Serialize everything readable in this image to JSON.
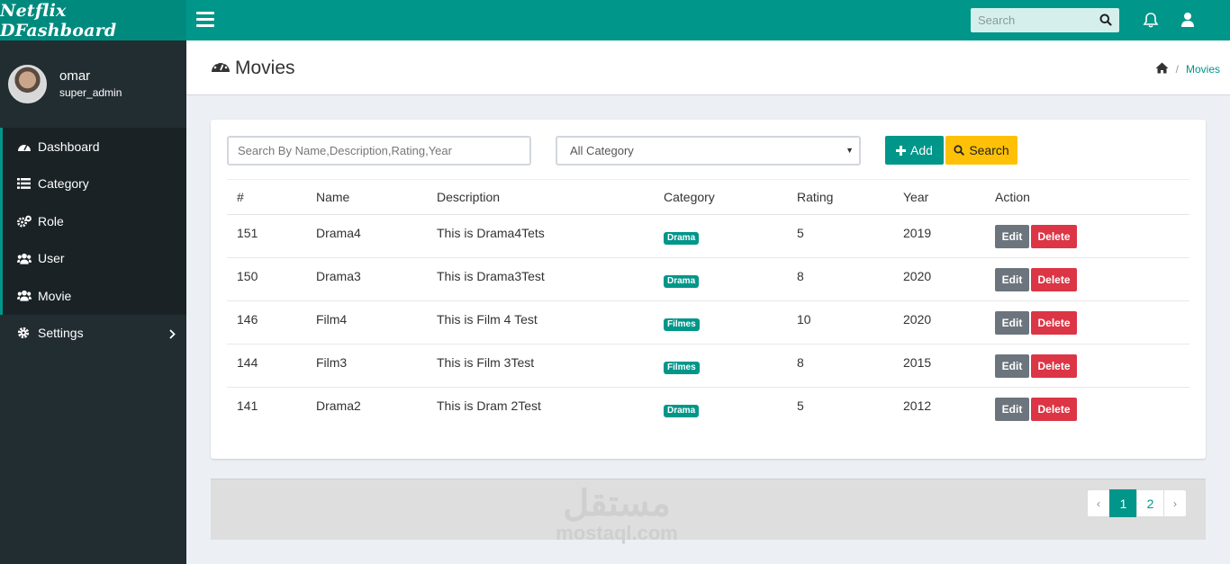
{
  "app": {
    "brand": "Netflix DFashboard"
  },
  "topbar": {
    "search_placeholder": "Search"
  },
  "user": {
    "name": "omar",
    "role": "super_admin"
  },
  "sidebar": {
    "items": [
      {
        "label": "Dashboard",
        "icon": "dashboard-icon",
        "active": true
      },
      {
        "label": "Category",
        "icon": "list-icon",
        "active": true
      },
      {
        "label": "Role",
        "icon": "cogs-icon",
        "active": true
      },
      {
        "label": "User",
        "icon": "users-icon",
        "active": true
      },
      {
        "label": "Movie",
        "icon": "users-icon",
        "active": true
      },
      {
        "label": "Settings",
        "icon": "gear-icon",
        "active": false
      }
    ]
  },
  "page": {
    "title": "Movies",
    "breadcrumb_current": "Movies"
  },
  "filters": {
    "search_placeholder": "Search By Name,Description,Rating,Year",
    "category_selected": "All Category",
    "add_label": "Add",
    "search_label": "Search"
  },
  "table": {
    "headers": [
      "#",
      "Name",
      "Description",
      "Category",
      "Rating",
      "Year",
      "Action"
    ],
    "rows": [
      {
        "id": "151",
        "name": "Drama4",
        "description": "This is Drama4Tets",
        "category": "Drama",
        "rating": "5",
        "year": "2019"
      },
      {
        "id": "150",
        "name": "Drama3",
        "description": "This is Drama3Test",
        "category": "Drama",
        "rating": "8",
        "year": "2020"
      },
      {
        "id": "146",
        "name": "Film4",
        "description": "This is Film 4 Test",
        "category": "Filmes",
        "rating": "10",
        "year": "2020"
      },
      {
        "id": "144",
        "name": "Film3",
        "description": "This is Film 3Test",
        "category": "Filmes",
        "rating": "8",
        "year": "2015"
      },
      {
        "id": "141",
        "name": "Drama2",
        "description": "This is Dram 2Test",
        "category": "Drama",
        "rating": "5",
        "year": "2012"
      }
    ],
    "edit_label": "Edit",
    "delete_label": "Delete"
  },
  "pagination": {
    "prev": "‹",
    "next": "›",
    "pages": [
      "1",
      "2"
    ],
    "current": "1"
  },
  "watermark": {
    "arabic": "مستقل",
    "latin": "mostaql.com"
  },
  "colors": {
    "primary": "#00968a",
    "sidebar": "#222d32",
    "warning": "#ffc107",
    "danger": "#dc3545",
    "secondary": "#6c757d"
  }
}
